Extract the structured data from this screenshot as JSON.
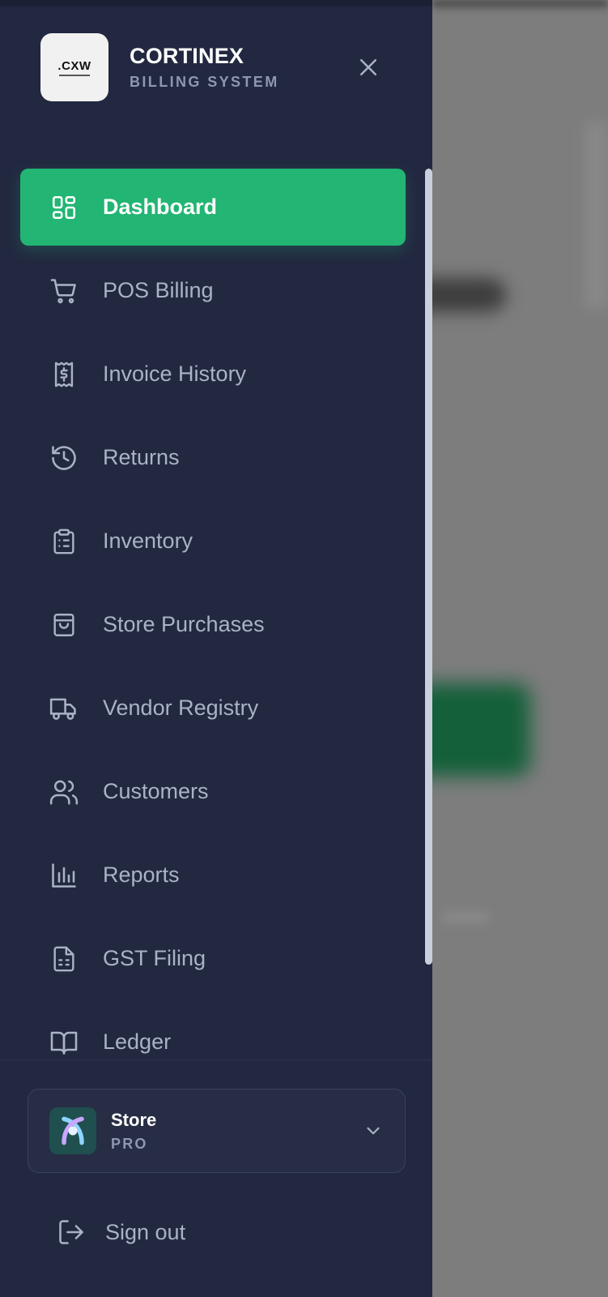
{
  "brand": {
    "logo_text": ".CXW",
    "name": "CORTINEX",
    "tagline": "BILLING SYSTEM"
  },
  "nav": {
    "items": [
      {
        "label": "Dashboard",
        "icon": "dashboard-grid-icon",
        "active": true
      },
      {
        "label": "POS Billing",
        "icon": "shopping-cart-icon",
        "active": false
      },
      {
        "label": "Invoice History",
        "icon": "receipt-dollar-icon",
        "active": false
      },
      {
        "label": "Returns",
        "icon": "history-clock-icon",
        "active": false
      },
      {
        "label": "Inventory",
        "icon": "clipboard-list-icon",
        "active": false
      },
      {
        "label": "Store Purchases",
        "icon": "shopping-bag-icon",
        "active": false
      },
      {
        "label": "Vendor Registry",
        "icon": "truck-icon",
        "active": false
      },
      {
        "label": "Customers",
        "icon": "users-icon",
        "active": false
      },
      {
        "label": "Reports",
        "icon": "bar-chart-icon",
        "active": false
      },
      {
        "label": "GST Filing",
        "icon": "file-spreadsheet-icon",
        "active": false
      },
      {
        "label": "Ledger",
        "icon": "open-book-icon",
        "active": false
      }
    ]
  },
  "store": {
    "name": "Store",
    "plan": "PRO"
  },
  "signout": {
    "label": "Sign out"
  },
  "colors": {
    "drawer_bg": "#222840",
    "active_bg": "#22b573",
    "nav_text": "#aab2c6",
    "muted_text": "#8d97b0"
  }
}
